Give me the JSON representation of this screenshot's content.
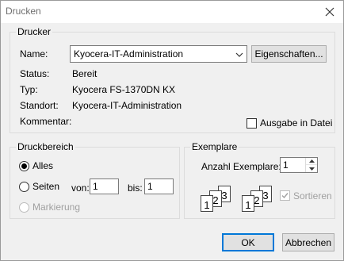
{
  "window": {
    "title": "Drucken"
  },
  "printer": {
    "group_label": "Drucker",
    "name_label": "Name:",
    "selected_printer": "Kyocera-IT-Administration",
    "properties_button": "Eigenschaften...",
    "status_label": "Status:",
    "status_value": "Bereit",
    "type_label": "Typ:",
    "type_value": "Kyocera FS-1370DN KX",
    "location_label": "Standort:",
    "location_value": "Kyocera-IT-Administration",
    "comment_label": "Kommentar:",
    "print_to_file_label": "Ausgabe in Datei",
    "print_to_file_checked": false
  },
  "print_range": {
    "group_label": "Druckbereich",
    "all_label": "Alles",
    "pages_label": "Seiten",
    "from_label": "von:",
    "from_value": "1",
    "to_label": "bis:",
    "to_value": "1",
    "selection_label": "Markierung",
    "selected_option": "all"
  },
  "copies": {
    "group_label": "Exemplare",
    "count_label": "Anzahl Exemplare:",
    "count_value": "1",
    "collate_label": "Sortieren",
    "collate_checked": true,
    "collate_pages": [
      "1",
      "2",
      "3"
    ]
  },
  "footer": {
    "ok_button": "OK",
    "cancel_button": "Abbrechen"
  },
  "colors": {
    "accent": "#0078d7",
    "disabled": "#a0a0a0"
  }
}
